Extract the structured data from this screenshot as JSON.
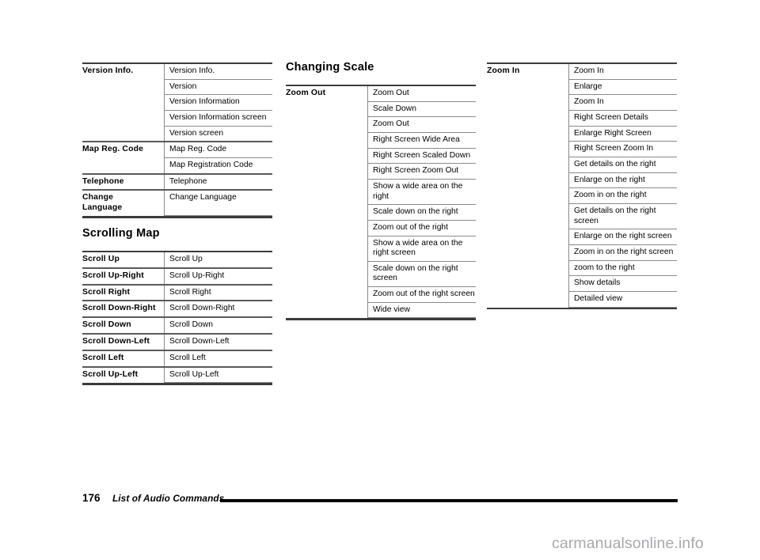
{
  "document": {
    "footer": {
      "page_number": "176",
      "title": "List of Audio Commands"
    },
    "watermark": "carmanualsonline.info"
  },
  "columns": {
    "col1": {
      "table_a": {
        "groups": [
          {
            "key": "Version Info.",
            "values": [
              "Version Info.",
              "Version",
              "Version Information",
              "Version Information screen",
              "Version screen"
            ]
          },
          {
            "key": "Map Reg. Code",
            "values": [
              "Map Reg. Code",
              "Map Registration Code"
            ]
          },
          {
            "key": "Telephone",
            "values": [
              "Telephone"
            ]
          },
          {
            "key": "Change\nLanguage",
            "key_lines": [
              "Change",
              "Language"
            ],
            "values": [
              "Change Language"
            ]
          }
        ]
      },
      "heading_b": "Scrolling Map",
      "table_b": {
        "groups": [
          {
            "key": "Scroll Up",
            "values": [
              "Scroll Up"
            ]
          },
          {
            "key": "Scroll Up-Right",
            "values": [
              "Scroll Up-Right"
            ]
          },
          {
            "key": "Scroll Right",
            "values": [
              "Scroll Right"
            ]
          },
          {
            "key": "Scroll Down-Right",
            "values": [
              "Scroll Down-Right"
            ]
          },
          {
            "key": "Scroll Down",
            "values": [
              "Scroll Down"
            ]
          },
          {
            "key": "Scroll Down-Left",
            "values": [
              "Scroll Down-Left"
            ]
          },
          {
            "key": "Scroll Left",
            "values": [
              "Scroll Left"
            ]
          },
          {
            "key": "Scroll Up-Left",
            "values": [
              "Scroll Up-Left"
            ]
          }
        ]
      }
    },
    "col2": {
      "heading": "Changing Scale",
      "table": {
        "groups": [
          {
            "key": "Zoom Out",
            "values": [
              "Zoom Out",
              "Scale Down",
              "Zoom Out",
              "Right Screen Wide Area",
              "Right Screen Scaled Down",
              "Right Screen Zoom Out",
              "Show a wide area on the right",
              "Scale down on the right",
              "Zoom out of the right",
              "Show a wide area on the right screen",
              "Scale down on the right screen",
              "Zoom out of the right screen",
              "Wide view"
            ]
          }
        ]
      }
    },
    "col3": {
      "table": {
        "groups": [
          {
            "key": "Zoom In",
            "values": [
              "Zoom In",
              "Enlarge",
              "Zoom In",
              "Right Screen Details",
              "Enlarge Right Screen",
              "Right Screen Zoom In",
              "Get details on the right",
              "Enlarge on the right",
              "Zoom in on the right",
              "Get details on the right screen",
              "Enlarge on the right screen",
              "Zoom in on the right screen",
              "zoom to the right",
              "Show details",
              "Detailed view"
            ]
          }
        ]
      }
    }
  }
}
